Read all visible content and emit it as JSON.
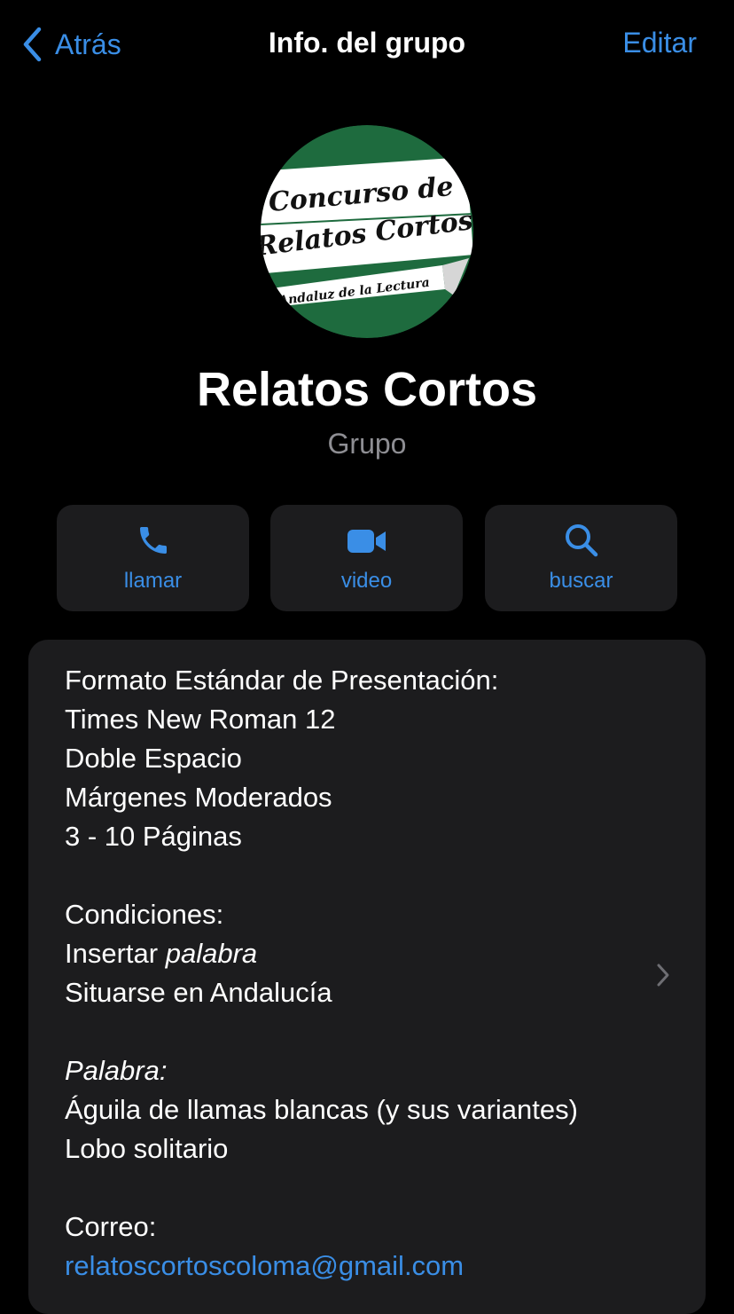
{
  "nav": {
    "back_label": "Atrás",
    "title": "Info. del grupo",
    "edit_label": "Editar"
  },
  "avatar": {
    "line1": "Concurso de",
    "line2": "Relatos Cortos",
    "line3": "Andaluz de la Lectura",
    "colors": {
      "green": "#1e6b3e",
      "white": "#ffffff"
    }
  },
  "group": {
    "name": "Relatos Cortos",
    "type": "Grupo"
  },
  "actions": [
    {
      "label": "llamar",
      "icon": "phone-icon"
    },
    {
      "label": "video",
      "icon": "video-camera-icon"
    },
    {
      "label": "buscar",
      "icon": "search-icon"
    }
  ],
  "description": {
    "format_title": "Formato Estándar de Presentación:",
    "format_lines": [
      "Times New Roman 12",
      "Doble Espacio",
      "Márgenes Moderados",
      "3 - 10 Páginas"
    ],
    "conditions_title": "Condiciones:",
    "condition_insert_prefix": "Insertar ",
    "condition_insert_word": "palabra",
    "condition_location": "Situarse en Andalucía",
    "words_title": "Palabra:",
    "words": [
      "Águila de llamas blancas (y sus variantes)",
      "Lobo solitario"
    ],
    "email_title": "Correo:",
    "email": "relatoscortoscoloma@gmail.com"
  },
  "theme": {
    "background": "#000000",
    "card": "#1c1c1e",
    "accent": "#3a8ee6",
    "secondary_text": "#8e8e93"
  }
}
